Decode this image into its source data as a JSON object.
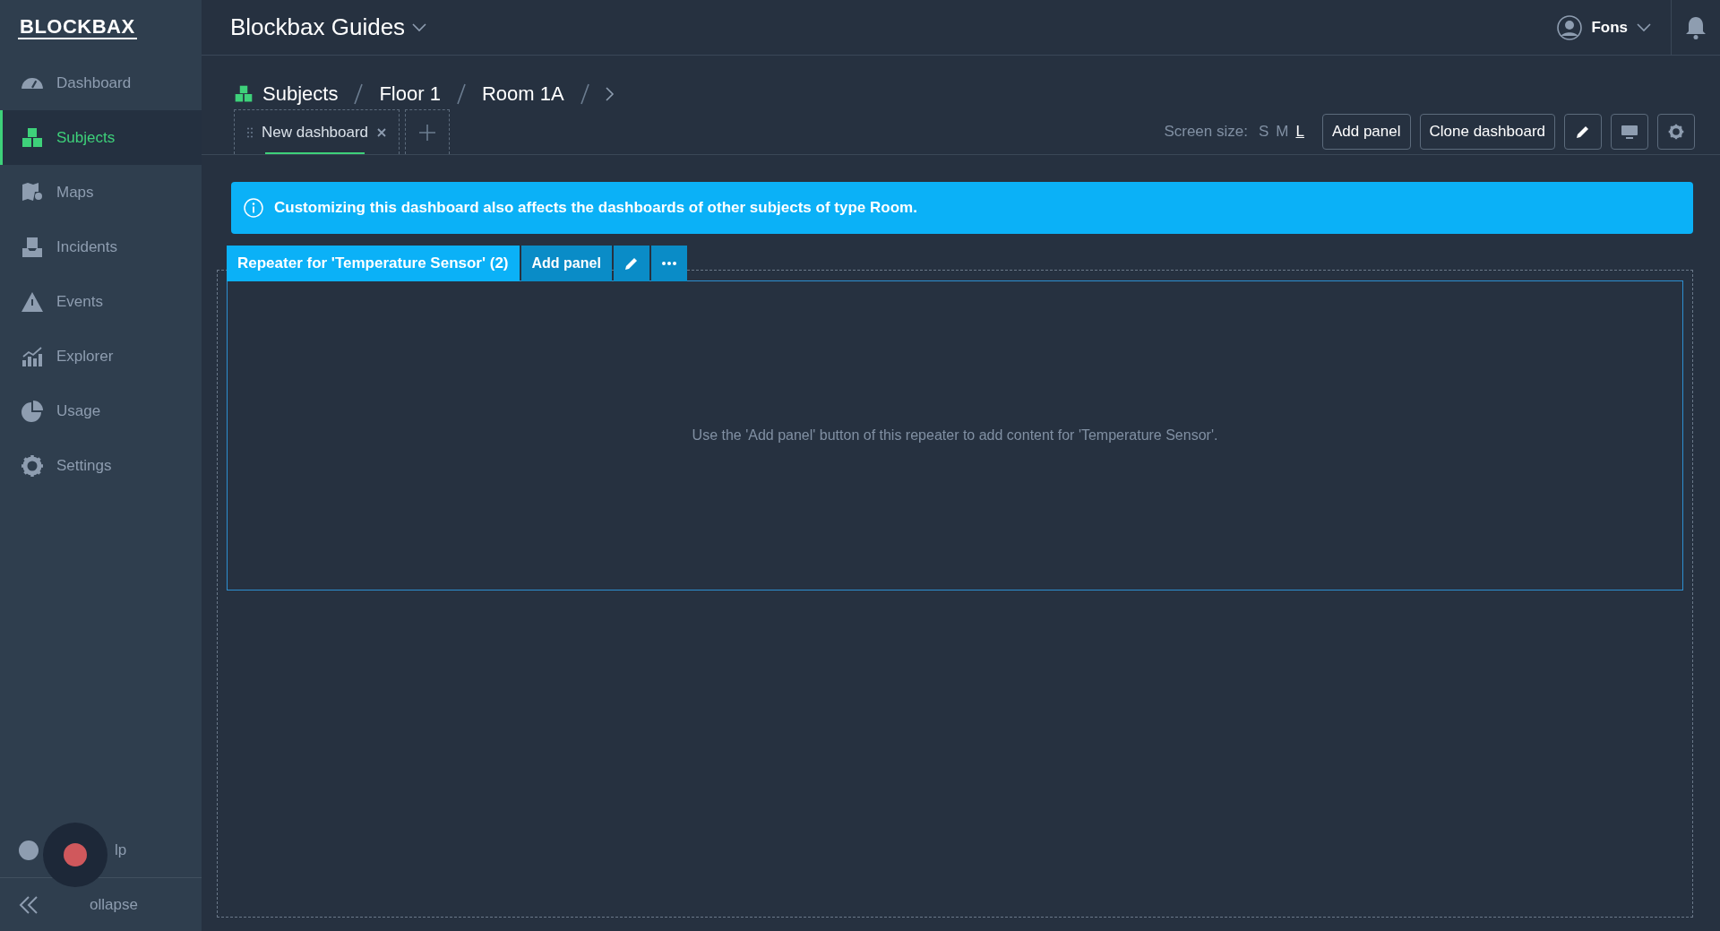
{
  "logo": "BLOCKBAX",
  "sidebar": {
    "items": [
      {
        "label": "Dashboard",
        "selected": false
      },
      {
        "label": "Subjects",
        "selected": true
      },
      {
        "label": "Maps",
        "selected": false
      },
      {
        "label": "Incidents",
        "selected": false
      },
      {
        "label": "Events",
        "selected": false
      },
      {
        "label": "Explorer",
        "selected": false
      },
      {
        "label": "Usage",
        "selected": false
      },
      {
        "label": "Settings",
        "selected": false
      }
    ],
    "help": "lp",
    "collapse": "ollapse"
  },
  "header": {
    "workspace": "Blockbax Guides",
    "user": "Fons"
  },
  "breadcrumb": [
    "Subjects",
    "Floor 1",
    "Room 1A"
  ],
  "tabs": [
    {
      "label": "New dashboard",
      "selected": true
    }
  ],
  "toolbar": {
    "screen_size_label": "Screen size:",
    "sizes": [
      {
        "label": "S",
        "selected": false
      },
      {
        "label": "M",
        "selected": false
      },
      {
        "label": "L",
        "selected": true
      }
    ],
    "buttons": [
      "Add panel",
      "Clone dashboard"
    ]
  },
  "alert": "Customizing this dashboard also affects the dashboards of other subjects of type Room.",
  "repeater": {
    "title": "Repeater for 'Temperature Sensor' (2)",
    "add_button": "Add panel",
    "empty_text": "Use the 'Add panel' button of this repeater to add content for 'Temperature Sensor'."
  }
}
